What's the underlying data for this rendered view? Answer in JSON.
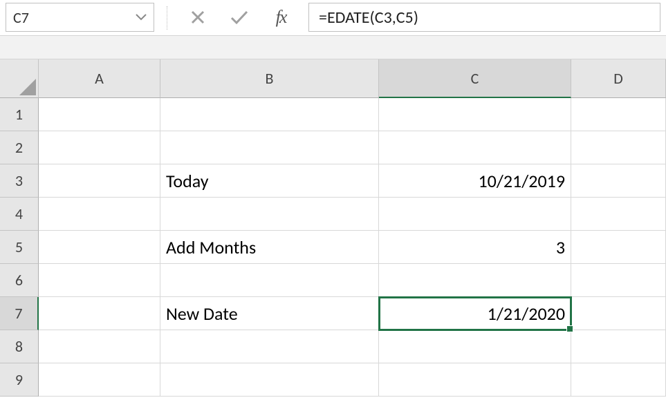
{
  "formula_bar": {
    "name_box_value": "C7",
    "cancel_icon": "✕",
    "enter_icon": "✓",
    "fx_label": "fx",
    "formula_text": "=EDATE(C3,C5)"
  },
  "columns": [
    "A",
    "B",
    "C",
    "D"
  ],
  "rows": [
    "1",
    "2",
    "3",
    "4",
    "5",
    "6",
    "7",
    "8",
    "9"
  ],
  "selected_cell": "C7",
  "cells": {
    "B3": "Today",
    "C3": "10/21/2019",
    "B5": "Add Months",
    "C5": "3",
    "B7": "New Date",
    "C7": "1/21/2020"
  }
}
